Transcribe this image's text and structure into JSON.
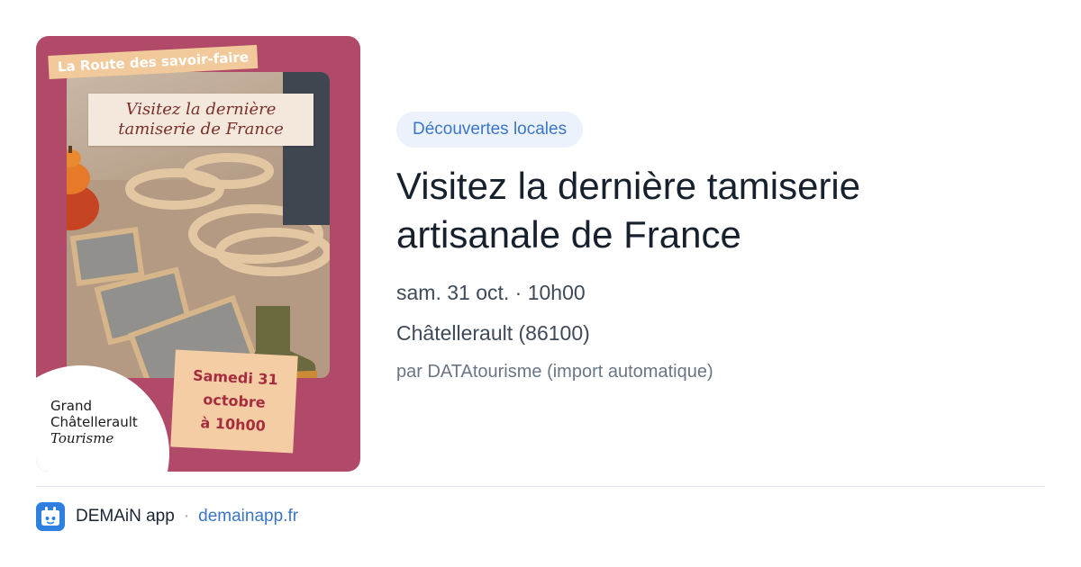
{
  "poster": {
    "banner": "La Route des savoir-faire",
    "title_line1": "Visitez la dernière",
    "title_line2": "tamiserie de France",
    "date_line1": "Samedi 31",
    "date_line2": "octobre",
    "date_line3": "à 10h00",
    "logo_line1": "Grand",
    "logo_line2": "Châtellerault",
    "logo_line3": "Tourisme"
  },
  "card": {
    "category": "Découvertes locales",
    "title": "Visitez la dernière tamiserie artisanale de France",
    "date": "sam. 31 oct. · 10h00",
    "location": "Châtellerault (86100)",
    "source": "par DATAtourisme (import automatique)"
  },
  "footer": {
    "app_name": "DEMAiN app",
    "separator": "·",
    "link": "demainapp.fr",
    "icon": "demain-app-icon"
  },
  "colors": {
    "poster_bg": "#b14a68",
    "badge_bg": "#ebf2fb",
    "accent": "#3b76c8"
  }
}
